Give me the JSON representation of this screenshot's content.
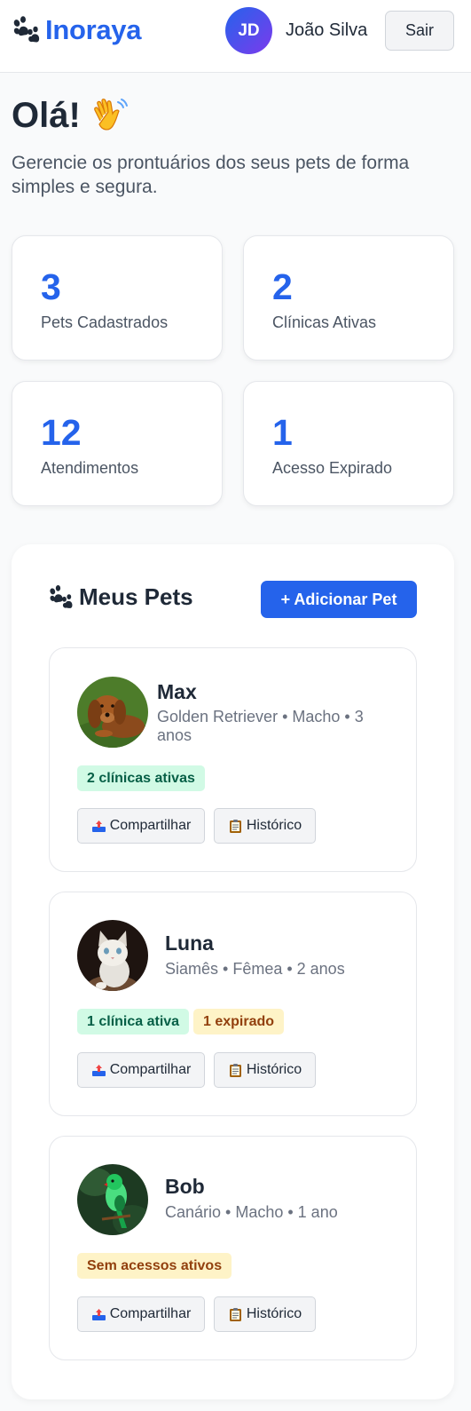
{
  "header": {
    "brand": "Inoraya",
    "user_initials": "JD",
    "user_name": "João Silva",
    "logout_label": "Sair"
  },
  "welcome": {
    "title": "Olá!",
    "subtitle": "Gerencie os prontuários dos seus pets de forma simples e segura."
  },
  "stats": [
    {
      "value": "3",
      "label": "Pets Cadastrados"
    },
    {
      "value": "2",
      "label": "Clínicas Ativas"
    },
    {
      "value": "12",
      "label": "Atendimentos"
    },
    {
      "value": "1",
      "label": "Acesso Expirado"
    }
  ],
  "pets_section": {
    "title": "Meus Pets",
    "add_label": "+ Adicionar Pet",
    "share_label": "Compartilhar",
    "history_label": "Histórico"
  },
  "pets": [
    {
      "name": "Max",
      "meta": "Golden Retriever • Macho • 3 anos",
      "badges": [
        "2 clínicas ativas"
      ]
    },
    {
      "name": "Luna",
      "meta": "Siamês • Fêmea • 2 anos",
      "badges": [
        "1 clínica ativa",
        "1 expirado"
      ]
    },
    {
      "name": "Bob",
      "meta": "Canário • Macho • 1 ano",
      "badges": [
        "Sem acessos ativos"
      ]
    }
  ],
  "icons": {
    "brand": "paw-icon",
    "welcome": "waving-hand-icon",
    "share": "outbox-tray-icon",
    "history": "clipboard-icon"
  },
  "colors": {
    "accent": "#2563eb",
    "badge_green_bg": "#d1fae5",
    "badge_yellow_bg": "#fef3c7"
  }
}
